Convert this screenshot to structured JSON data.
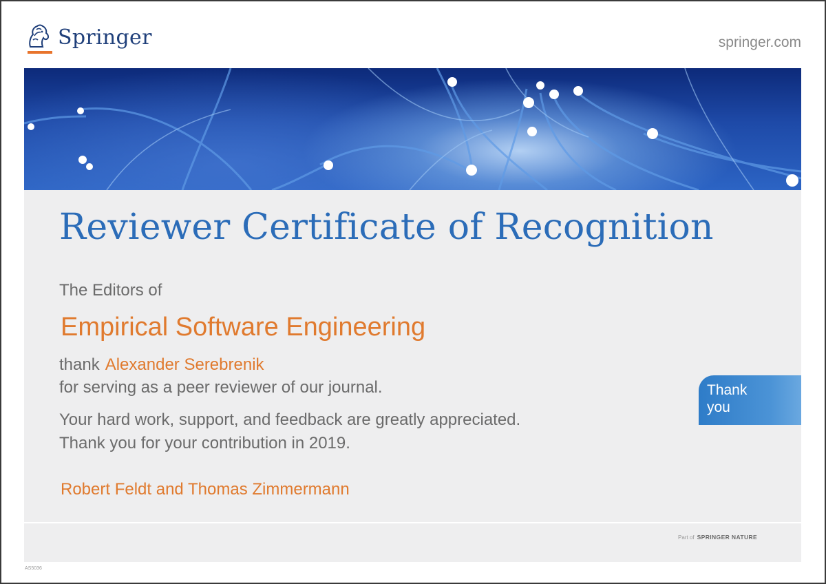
{
  "header": {
    "brand": "Springer",
    "logo_icon": "springer-horse-icon",
    "website": "springer.com"
  },
  "certificate": {
    "title": "Reviewer Certificate of Recognition",
    "editors_of": "The Editors of",
    "journal": "Empirical Software Engineering",
    "thank_word": "thank",
    "reviewer_name": "Alexander Serebrenik",
    "serving_line": "for serving as a peer reviewer of our journal.",
    "appreciation_line": "Your hard work, support, and feedback are greatly appreciated.",
    "contribution_line": "Thank you for your contribution in 2019.",
    "signers": "Robert Feldt and Thomas Zimmermann"
  },
  "badge": {
    "line1": "Thank",
    "line2": "you"
  },
  "footer": {
    "part_of": "Part of",
    "publisher": "SPRINGER NATURE",
    "document_code": "AS5036"
  },
  "colors": {
    "title_blue": "#2b6cb8",
    "accent_orange": "#e07a2e",
    "body_gray": "#6b6b6b",
    "panel_gray": "#eeeeef",
    "brand_navy": "#1f3f7a"
  }
}
